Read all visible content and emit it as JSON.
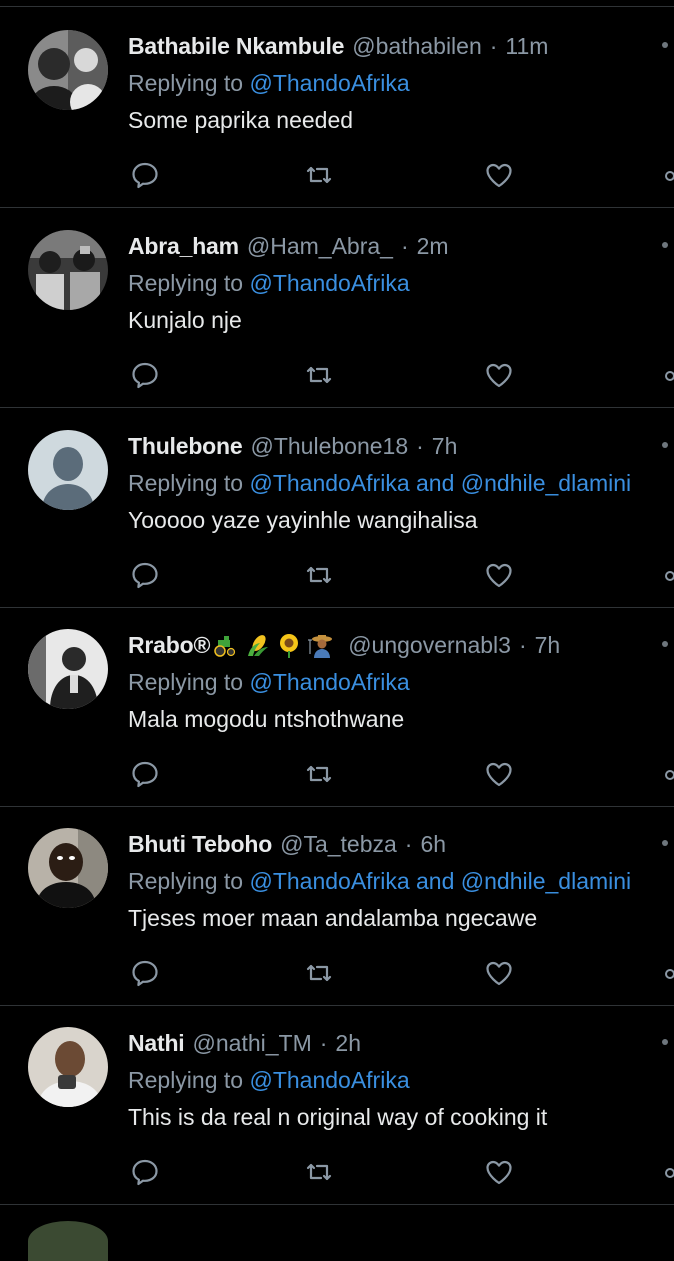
{
  "tweets": [
    {
      "name": "Bathabile Nkambule",
      "handle": "@bathabilen",
      "time": "11m",
      "replying_prefix": "Replying to ",
      "mentions": "@ThandoAfrika",
      "text": "Some paprika needed"
    },
    {
      "name": "Abra_ham",
      "handle": "@Ham_Abra_",
      "time": "2m",
      "replying_prefix": "Replying to ",
      "mentions": "@ThandoAfrika",
      "text": "Kunjalo nje"
    },
    {
      "name": "Thulebone",
      "handle": "@Thulebone18",
      "time": "7h",
      "replying_prefix": "Replying to ",
      "mentions": "@ThandoAfrika and @ndhile_dlamini",
      "text": "Yooooo yaze yayinhle wangihalisa"
    },
    {
      "name": "Rrabo®",
      "name_emojis": [
        "tractor-emoji",
        "corn-emoji",
        "sunflower-emoji",
        "farmer-emoji"
      ],
      "handle": "@ungovernabl3",
      "time": "7h",
      "replying_prefix": "Replying to ",
      "mentions": "@ThandoAfrika",
      "text": "Mala mogodu ntshothwane"
    },
    {
      "name": "Bhuti Teboho",
      "handle": "@Ta_tebza",
      "time": "6h",
      "replying_prefix": "Replying to ",
      "mentions": "@ThandoAfrika and @ndhile_dlamini",
      "text": "Tjeses moer maan andalamba ngecawe"
    },
    {
      "name": "Nathi",
      "handle": "@nathi_TM",
      "time": "2h",
      "replying_prefix": "Replying to ",
      "mentions": "@ThandoAfrika",
      "text": "This is da real n original way of cooking it"
    }
  ],
  "separator": "·",
  "icons": {
    "reply": "reply-icon",
    "retweet": "retweet-icon",
    "like": "like-icon",
    "share": "share-icon",
    "more": "more-icon"
  },
  "colors": {
    "background": "#000000",
    "text": "#e7e9ea",
    "muted": "#8b98a5",
    "mention": "#3a8fe0",
    "divider": "#2f3336"
  }
}
